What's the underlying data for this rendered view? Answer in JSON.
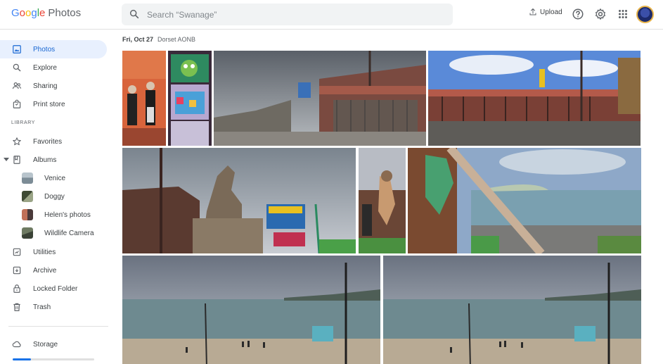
{
  "app": {
    "logo_google": "Google",
    "logo_product": "Photos"
  },
  "header": {
    "search_placeholder": "Search “Swanage”",
    "upload_label": "Upload",
    "icons": [
      "search-icon",
      "upload-icon",
      "help-icon",
      "settings-icon",
      "apps-grid-icon",
      "avatar"
    ]
  },
  "sidebar": {
    "items": [
      {
        "label": "Photos",
        "icon": "photos-icon",
        "active": true
      },
      {
        "label": "Explore",
        "icon": "search-icon"
      },
      {
        "label": "Sharing",
        "icon": "people-icon"
      },
      {
        "label": "Print store",
        "icon": "shopping-bag-icon"
      }
    ],
    "library_heading": "LIBRARY",
    "library_items": [
      {
        "label": "Favorites",
        "icon": "star-icon"
      },
      {
        "label": "Albums",
        "icon": "album-icon"
      }
    ],
    "albums": [
      {
        "label": "Venice",
        "color": "#8a9aa8"
      },
      {
        "label": "Doggy",
        "color": "#6b7a5a"
      },
      {
        "label": "Helen's photos",
        "color": "#a86a5a"
      },
      {
        "label": "Wildlife Camera",
        "color": "#5c6b58"
      }
    ],
    "more_items": [
      {
        "label": "Utilities",
        "icon": "utilities-icon"
      },
      {
        "label": "Archive",
        "icon": "archive-icon"
      },
      {
        "label": "Locked Folder",
        "icon": "lock-icon"
      },
      {
        "label": "Trash",
        "icon": "trash-icon"
      }
    ],
    "storage_label": "Storage",
    "storage_used_fraction": 0.22
  },
  "main": {
    "date": "Fri, Oct 27",
    "location": "Dorset AONB"
  },
  "colors": {
    "accent": "#1a73e8",
    "active_bg": "#e8f0fe"
  }
}
